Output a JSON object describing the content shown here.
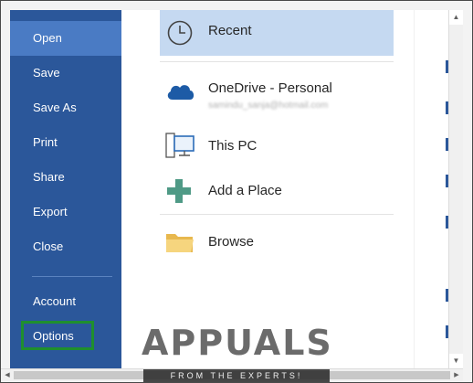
{
  "sidebar": {
    "items": [
      {
        "id": "open",
        "label": "Open"
      },
      {
        "id": "save",
        "label": "Save"
      },
      {
        "id": "saveas",
        "label": "Save As"
      },
      {
        "id": "print",
        "label": "Print"
      },
      {
        "id": "share",
        "label": "Share"
      },
      {
        "id": "export",
        "label": "Export"
      },
      {
        "id": "close",
        "label": "Close"
      },
      {
        "id": "account",
        "label": "Account"
      },
      {
        "id": "options",
        "label": "Options"
      }
    ],
    "active": "Open",
    "highlighted": "Options"
  },
  "places": {
    "recent": {
      "label": "Recent",
      "icon": "clock-icon"
    },
    "onedrive": {
      "label": "OneDrive - Personal",
      "email": "samindu_sanja@hotmail.com",
      "icon": "cloud-icon"
    },
    "thispc": {
      "label": "This PC",
      "icon": "computer-icon"
    },
    "addplace": {
      "label": "Add a Place",
      "icon": "plus-icon"
    },
    "browse": {
      "label": "Browse",
      "icon": "folder-icon"
    }
  },
  "watermark": {
    "logo": "APPUALS",
    "tagline": "FROM THE EXPERTS!"
  },
  "colors": {
    "sidebar": "#2b579a",
    "sidebar_active": "#4a7bc4",
    "selected_place": "#c5d9f1",
    "highlight_border": "#1f8f2e"
  }
}
